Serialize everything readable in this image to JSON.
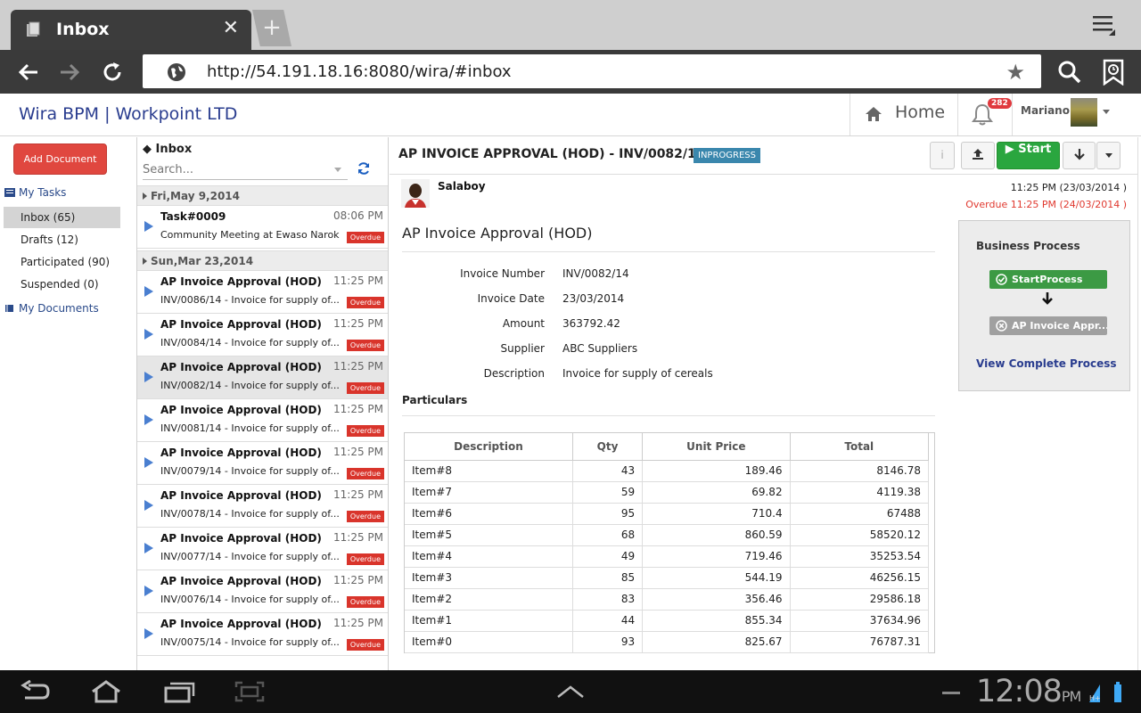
{
  "browser": {
    "tab_title": "Inbox",
    "tab_close": "✕",
    "new_tab": "+",
    "url": "http://54.191.18.16:8080/wira/#inbox"
  },
  "app": {
    "brand": "Wira BPM | Workpoint LTD",
    "home_label": "Home",
    "notification_count": "282",
    "user_name": "Mariano"
  },
  "leftnav": {
    "add_document": "Add Document",
    "my_tasks": "My Tasks",
    "items": [
      {
        "label": "Inbox (65)",
        "active": true
      },
      {
        "label": "Drafts (12)",
        "active": false
      },
      {
        "label": "Participated (90)",
        "active": false
      },
      {
        "label": "Suspended (0)",
        "active": false
      }
    ],
    "my_documents": "My Documents"
  },
  "inbox": {
    "title": "Inbox",
    "search_placeholder": "Search...",
    "groups": [
      {
        "date": "Fri,May 9,2014",
        "tasks": [
          {
            "title": "Task#0009",
            "time": "08:06 PM",
            "subtitle": "Community Meeting at Ewaso Narok",
            "badge": "Overdue",
            "selected": false
          }
        ]
      },
      {
        "date": "Sun,Mar 23,2014",
        "tasks": [
          {
            "title": "AP Invoice Approval (HOD)",
            "time": "11:25 PM",
            "subtitle": "INV/0086/14 - Invoice for supply of...",
            "badge": "Overdue",
            "selected": false
          },
          {
            "title": "AP Invoice Approval (HOD)",
            "time": "11:25 PM",
            "subtitle": "INV/0084/14 - Invoice for supply of...",
            "badge": "Overdue",
            "selected": false
          },
          {
            "title": "AP Invoice Approval (HOD)",
            "time": "11:25 PM",
            "subtitle": "INV/0082/14 - Invoice for supply of...",
            "badge": "Overdue",
            "selected": true
          },
          {
            "title": "AP Invoice Approval (HOD)",
            "time": "11:25 PM",
            "subtitle": "INV/0081/14 - Invoice for supply of...",
            "badge": "Overdue",
            "selected": false
          },
          {
            "title": "AP Invoice Approval (HOD)",
            "time": "11:25 PM",
            "subtitle": "INV/0079/14 - Invoice for supply of...",
            "badge": "Overdue",
            "selected": false
          },
          {
            "title": "AP Invoice Approval (HOD)",
            "time": "11:25 PM",
            "subtitle": "INV/0078/14 - Invoice for supply of...",
            "badge": "Overdue",
            "selected": false
          },
          {
            "title": "AP Invoice Approval (HOD)",
            "time": "11:25 PM",
            "subtitle": "INV/0077/14 - Invoice for supply of...",
            "badge": "Overdue",
            "selected": false
          },
          {
            "title": "AP Invoice Approval (HOD)",
            "time": "11:25 PM",
            "subtitle": "INV/0076/14 - Invoice for supply of...",
            "badge": "Overdue",
            "selected": false
          },
          {
            "title": "AP Invoice Approval (HOD)",
            "time": "11:25 PM",
            "subtitle": "INV/0075/14 - Invoice for supply of...",
            "badge": "Overdue",
            "selected": false
          }
        ]
      }
    ]
  },
  "detail": {
    "title": "AP INVOICE APPROVAL (HOD) -  INV/0082/14",
    "status": "INPROGRESS",
    "info_label": "i",
    "start_label": "Start",
    "creator": "Salaboy",
    "created": "11:25 PM (23/03/2014 )",
    "due": "Overdue 11:25 PM (24/03/2014 )",
    "form_title": "AP Invoice Approval (HOD)",
    "fields": [
      {
        "label": "Invoice Number",
        "value": "INV/0082/14"
      },
      {
        "label": "Invoice Date",
        "value": "23/03/2014"
      },
      {
        "label": "Amount",
        "value": "363792.42"
      },
      {
        "label": "Supplier",
        "value": "ABC Suppliers"
      },
      {
        "label": "Description",
        "value": "Invoice for supply of cereals"
      }
    ],
    "particulars_title": "Particulars",
    "table": {
      "headers": [
        "Description",
        "Qty",
        "Unit Price",
        "Total"
      ],
      "rows": [
        [
          "Item#8",
          "43",
          "189.46",
          "8146.78"
        ],
        [
          "Item#7",
          "59",
          "69.82",
          "4119.38"
        ],
        [
          "Item#6",
          "95",
          "710.4",
          "67488"
        ],
        [
          "Item#5",
          "68",
          "860.59",
          "58520.12"
        ],
        [
          "Item#4",
          "49",
          "719.46",
          "35253.54"
        ],
        [
          "Item#3",
          "85",
          "544.19",
          "46256.15"
        ],
        [
          "Item#2",
          "83",
          "356.46",
          "29586.18"
        ],
        [
          "Item#1",
          "44",
          "855.34",
          "37634.96"
        ],
        [
          "Item#0",
          "93",
          "825.67",
          "76787.31"
        ]
      ]
    },
    "business_process": {
      "title": "Business Process",
      "step1": "StartProcess",
      "step2": "AP Invoice Appr...",
      "link": "View Complete Process"
    }
  },
  "system": {
    "clock": "12:08",
    "ampm": "PM"
  },
  "colors": {
    "brand": "#2a3d8f",
    "add_button": "#e0473f",
    "start_button": "#2aa63f",
    "status_badge": "#3a87ad",
    "overdue": "#d9342b"
  }
}
